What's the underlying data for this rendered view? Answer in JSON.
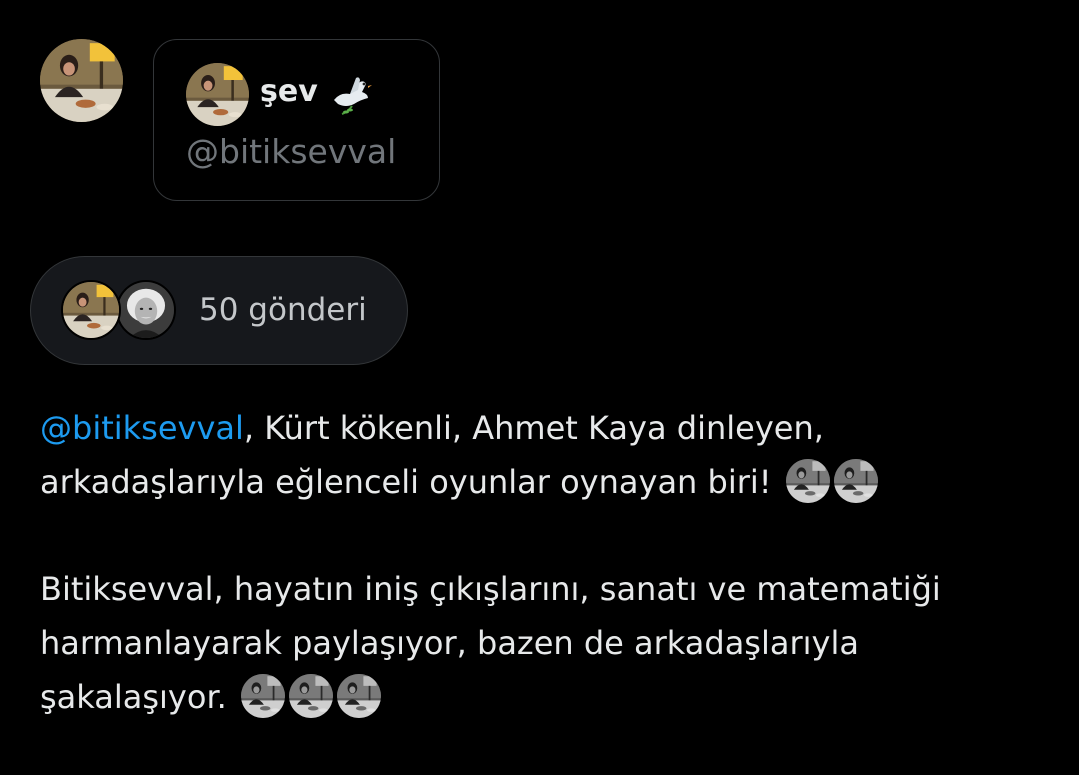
{
  "profile": {
    "display_name": "şev",
    "handle": "@bitiksevval",
    "avatar_icon": "user-photo-avatar",
    "badge_icon": "dove-icon"
  },
  "posts_summary": {
    "count_label": "50 gönderi",
    "avatars": [
      "user-photo-avatar",
      "einstein-photo-avatar"
    ]
  },
  "bio": {
    "paragraph1": {
      "mention": "@bitiksevval",
      "text_line1": ", Kürt kökenli, Ahmet Kaya dinleyen,",
      "text_line2": "arkadaşlarıyla eğlenceli oyunlar oynayan biri!",
      "emoji_count": 2
    },
    "paragraph2": {
      "line1": "Bitiksevval, hayatın iniş çıkışlarını, sanatı ve matematiği",
      "line2": "harmanlayarak paylaşıyor, bazen de arkadaşlarıyla",
      "line3": "şakalaşıyor.",
      "emoji_count": 3
    }
  },
  "colors": {
    "background": "#000000",
    "text": "#e7e9ea",
    "secondary_text": "#71767b",
    "mention": "#1d9bf0",
    "border": "#333639"
  }
}
